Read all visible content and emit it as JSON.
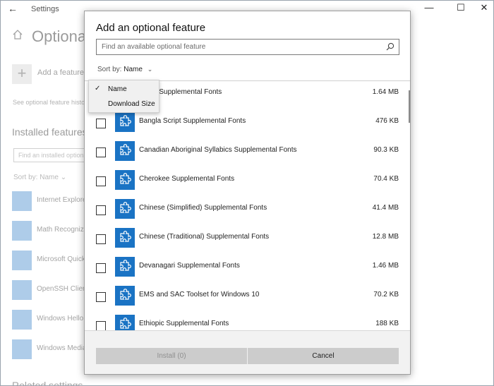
{
  "window": {
    "back_glyph": "←",
    "app_title": "Settings",
    "controls": {
      "minimize": "—",
      "maximize": "☐",
      "close": "✕"
    }
  },
  "background": {
    "page_title": "Optional features",
    "add_feature_label": "Add a feature",
    "add_feature_glyph": "+",
    "history_link": "See optional feature history",
    "installed_heading": "Installed features",
    "installed_search_placeholder": "Find an installed optional feature",
    "sort_label": "Sort by:",
    "sort_value": "Name",
    "installed_items": [
      {
        "name": "Internet Explorer 11"
      },
      {
        "name": "Math Recognizer"
      },
      {
        "name": "Microsoft Quick Assist"
      },
      {
        "name": "OpenSSH Client"
      },
      {
        "name": "Windows Hello Face"
      },
      {
        "name": "Windows Media Player"
      }
    ],
    "related_heading": "Related settings"
  },
  "dialog": {
    "title": "Add an optional feature",
    "search_placeholder": "Find an available optional feature",
    "search_icon": "search-icon",
    "sort_label": "Sort by:",
    "sort_value": "Name",
    "features": [
      {
        "name": "Script Supplemental Fonts",
        "size": "1.64 MB"
      },
      {
        "name": "Bangla Script Supplemental Fonts",
        "size": "476 KB"
      },
      {
        "name": "Canadian Aboriginal Syllabics Supplemental Fonts",
        "size": "90.3 KB"
      },
      {
        "name": "Cherokee Supplemental Fonts",
        "size": "70.4 KB"
      },
      {
        "name": "Chinese (Simplified) Supplemental Fonts",
        "size": "41.4 MB"
      },
      {
        "name": "Chinese (Traditional) Supplemental Fonts",
        "size": "12.8 MB"
      },
      {
        "name": "Devanagari Supplemental Fonts",
        "size": "1.46 MB"
      },
      {
        "name": "EMS and SAC Toolset for Windows 10",
        "size": "70.2 KB"
      },
      {
        "name": "Ethiopic Supplemental Fonts",
        "size": "188 KB"
      }
    ],
    "install_label": "Install (0)",
    "cancel_label": "Cancel"
  },
  "sort_menu": {
    "items": [
      {
        "label": "Name",
        "checked": true,
        "check_glyph": "✓"
      },
      {
        "label": "Download Size",
        "checked": false
      }
    ]
  },
  "colors": {
    "accent": "#1a73c4",
    "tile_faded": "#4e8fd0",
    "button_bg": "#cccccc"
  }
}
